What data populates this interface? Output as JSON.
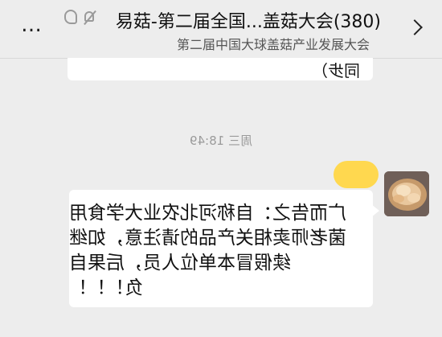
{
  "header": {
    "title": "易菇-第二届全国...盖菇大会(380)",
    "subtitle": "第二届中国大球盖菇产业发展大会",
    "more_label": "…",
    "icons": [
      "ear-icon",
      "mute-icon"
    ]
  },
  "chat": {
    "previous_message_tail": "同步）",
    "timestamp": "周三 18:49",
    "message_lines": [
      "广而告之：自称河北农业大学食用",
      "菌老师卖相关产品的请注意，如继",
      "续假冒本单位人员，后果自",
      "负！！！"
    ]
  },
  "colors": {
    "background": "#ededed",
    "bubble": "#ffffff",
    "highlight": "#ffd84f",
    "meta_text": "#9b9b9b"
  }
}
